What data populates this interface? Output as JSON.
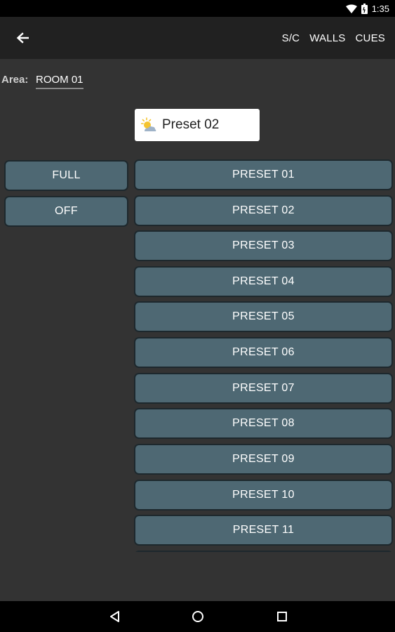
{
  "status": {
    "time": "1:35",
    "icons": [
      "wifi-icon",
      "battery-icon"
    ]
  },
  "appbar": {
    "back_icon": "arrow-left-icon",
    "actions": [
      "S/C",
      "WALLS",
      "CUES"
    ]
  },
  "area": {
    "label": "Area:",
    "value": "ROOM 01"
  },
  "current_preset": {
    "icon": "sun-icon",
    "label": "Preset 02"
  },
  "left_buttons": [
    "FULL",
    "OFF"
  ],
  "presets": [
    "PRESET 01",
    "PRESET 02",
    "PRESET 03",
    "PRESET 04",
    "PRESET 05",
    "PRESET 06",
    "PRESET 07",
    "PRESET 08",
    "PRESET 09",
    "PRESET 10",
    "PRESET 11"
  ],
  "navbar": {
    "icons": [
      "back-triangle-icon",
      "home-circle-icon",
      "recents-square-icon"
    ]
  },
  "colors": {
    "button_fill": "#4e6873",
    "button_border": "#1d282d",
    "background": "#333333",
    "appbar": "#212121",
    "sun": "#f4c430"
  }
}
